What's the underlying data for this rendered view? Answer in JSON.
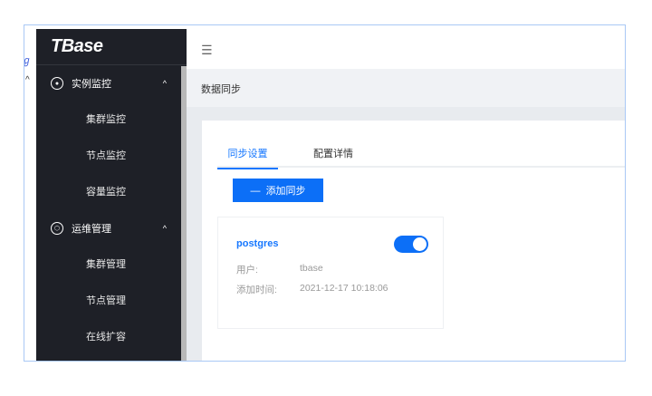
{
  "logo": "TBase",
  "sidebar": {
    "groups": [
      {
        "label": "实例监控",
        "items": [
          "集群监控",
          "节点监控",
          "容量监控"
        ]
      },
      {
        "label": "运维管理",
        "items": [
          "集群管理",
          "节点管理",
          "在线扩容"
        ]
      }
    ]
  },
  "breadcrumb": "数据同步",
  "tabs": [
    "同步设置",
    "配置详情"
  ],
  "add_button": "添加同步",
  "sync_card": {
    "name": "postgres",
    "enabled": true,
    "user_label": "用户:",
    "user": "tbase",
    "time_label": "添加时间:",
    "time": "2021-12-17 10:18:06"
  },
  "colors": {
    "accent": "#0c6ff7",
    "sidebar": "#1e2027"
  }
}
